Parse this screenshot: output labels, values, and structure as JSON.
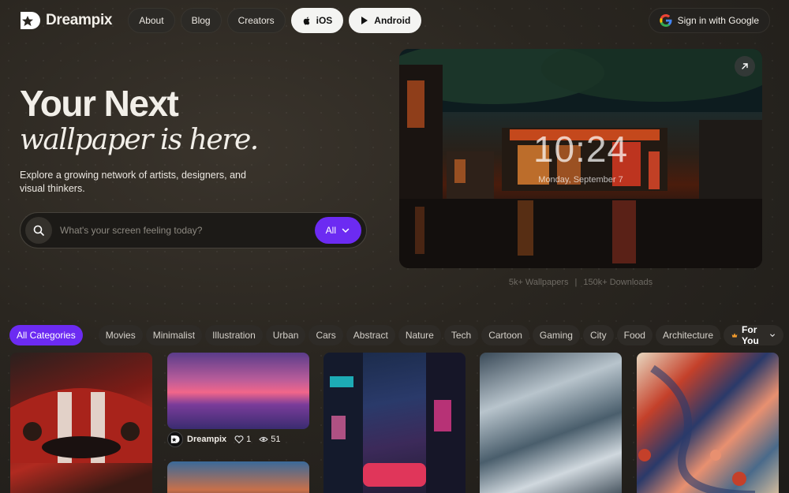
{
  "nav": {
    "brand": "Dreampix",
    "links": [
      "About",
      "Blog",
      "Creators"
    ],
    "ios_label": "iOS",
    "android_label": "Android",
    "signin_label": "Sign in with Google"
  },
  "hero": {
    "title": "Your Next",
    "subtitle": "wallpaper is here.",
    "description": "Explore a growing network of artists, designers, and visual thinkers.",
    "search_placeholder": "What's your screen feeling today?",
    "filter_label": "All",
    "preview_time": "10:24",
    "preview_date": "Monday, September 7",
    "stats": [
      "5k+ Wallpapers",
      "150k+ Downloads"
    ],
    "stats_separator": "|"
  },
  "categories": {
    "active": "All Categories",
    "items": [
      "Movies",
      "Minimalist",
      "Illustration",
      "Urban",
      "Cars",
      "Abstract",
      "Nature",
      "Tech",
      "Cartoon",
      "Gaming",
      "City",
      "Food",
      "Architecture"
    ],
    "sort_label": "For You"
  },
  "featured_card": {
    "author": "Dreampix",
    "likes": "1",
    "views": "51"
  },
  "colors": {
    "accent": "#6c2bf2",
    "background": "#2a2620"
  }
}
